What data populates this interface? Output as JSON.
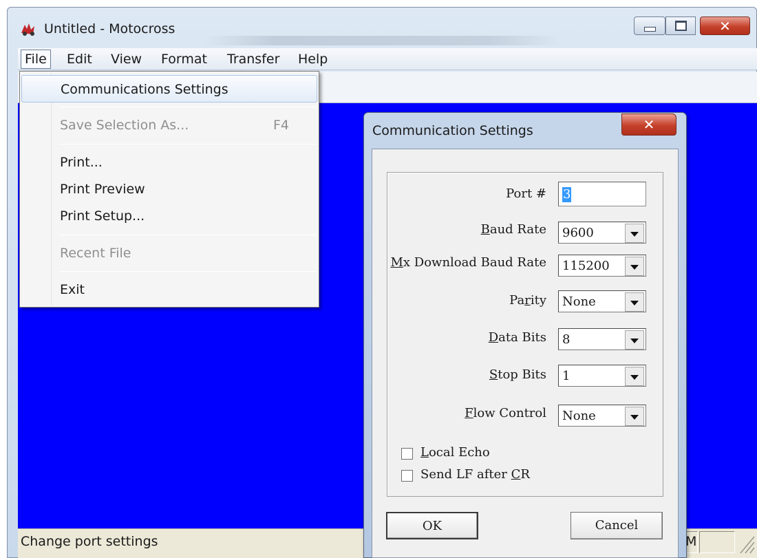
{
  "window": {
    "title": "Untitled - Motocross",
    "icon": "motocross-app-icon"
  },
  "menubar": {
    "items": [
      {
        "label": "File"
      },
      {
        "label": "Edit"
      },
      {
        "label": "View"
      },
      {
        "label": "Format"
      },
      {
        "label": "Transfer"
      },
      {
        "label": "Help"
      }
    ]
  },
  "file_menu": {
    "items": [
      {
        "label": "Communications Settings",
        "shortcut": "",
        "enabled": true,
        "highlighted": true
      },
      {
        "label": "Save Selection As...",
        "shortcut": "F4",
        "enabled": false
      },
      {
        "label": "Print...",
        "shortcut": "",
        "enabled": true
      },
      {
        "label": "Print Preview",
        "shortcut": "",
        "enabled": true
      },
      {
        "label": "Print Setup...",
        "shortcut": "",
        "enabled": true
      },
      {
        "label": "Recent File",
        "shortcut": "",
        "enabled": false
      },
      {
        "label": "Exit",
        "shortcut": "",
        "enabled": true
      }
    ]
  },
  "dialog": {
    "title": "Communication Settings",
    "port": {
      "label": "Port #",
      "value": "3"
    },
    "baud_rate": {
      "label_prefix": "",
      "label_hotkey": "B",
      "label_rest": "aud Rate",
      "value": "9600"
    },
    "mx_baud_rate": {
      "label_prefix": "",
      "label_hotkey": "M",
      "label_rest": "x Download Baud Rate",
      "value": "115200"
    },
    "parity": {
      "label_prefix": "Pa",
      "label_hotkey": "r",
      "label_rest": "ity",
      "value": "None"
    },
    "data_bits": {
      "label_prefix": "",
      "label_hotkey": "D",
      "label_rest": "ata Bits",
      "value": "8"
    },
    "stop_bits": {
      "label_prefix": "",
      "label_hotkey": "S",
      "label_rest": "top Bits",
      "value": "1"
    },
    "flow_control": {
      "label_prefix": "",
      "label_hotkey": "F",
      "label_rest": "low Control",
      "value": "None"
    },
    "local_echo": {
      "label_prefix": "",
      "label_hotkey": "L",
      "label_rest": "ocal Echo",
      "checked": false
    },
    "send_lf": {
      "label_prefix": "Send LF after ",
      "label_hotkey": "C",
      "label_rest": "R",
      "checked": false
    },
    "ok_label": "OK",
    "cancel_label": "Cancel"
  },
  "status_bar": {
    "text": "Change port settings",
    "panel_text": "M"
  },
  "colors": {
    "client_background": "#0000ff",
    "selection": "#3399ff",
    "close_button": "#c5412b"
  }
}
